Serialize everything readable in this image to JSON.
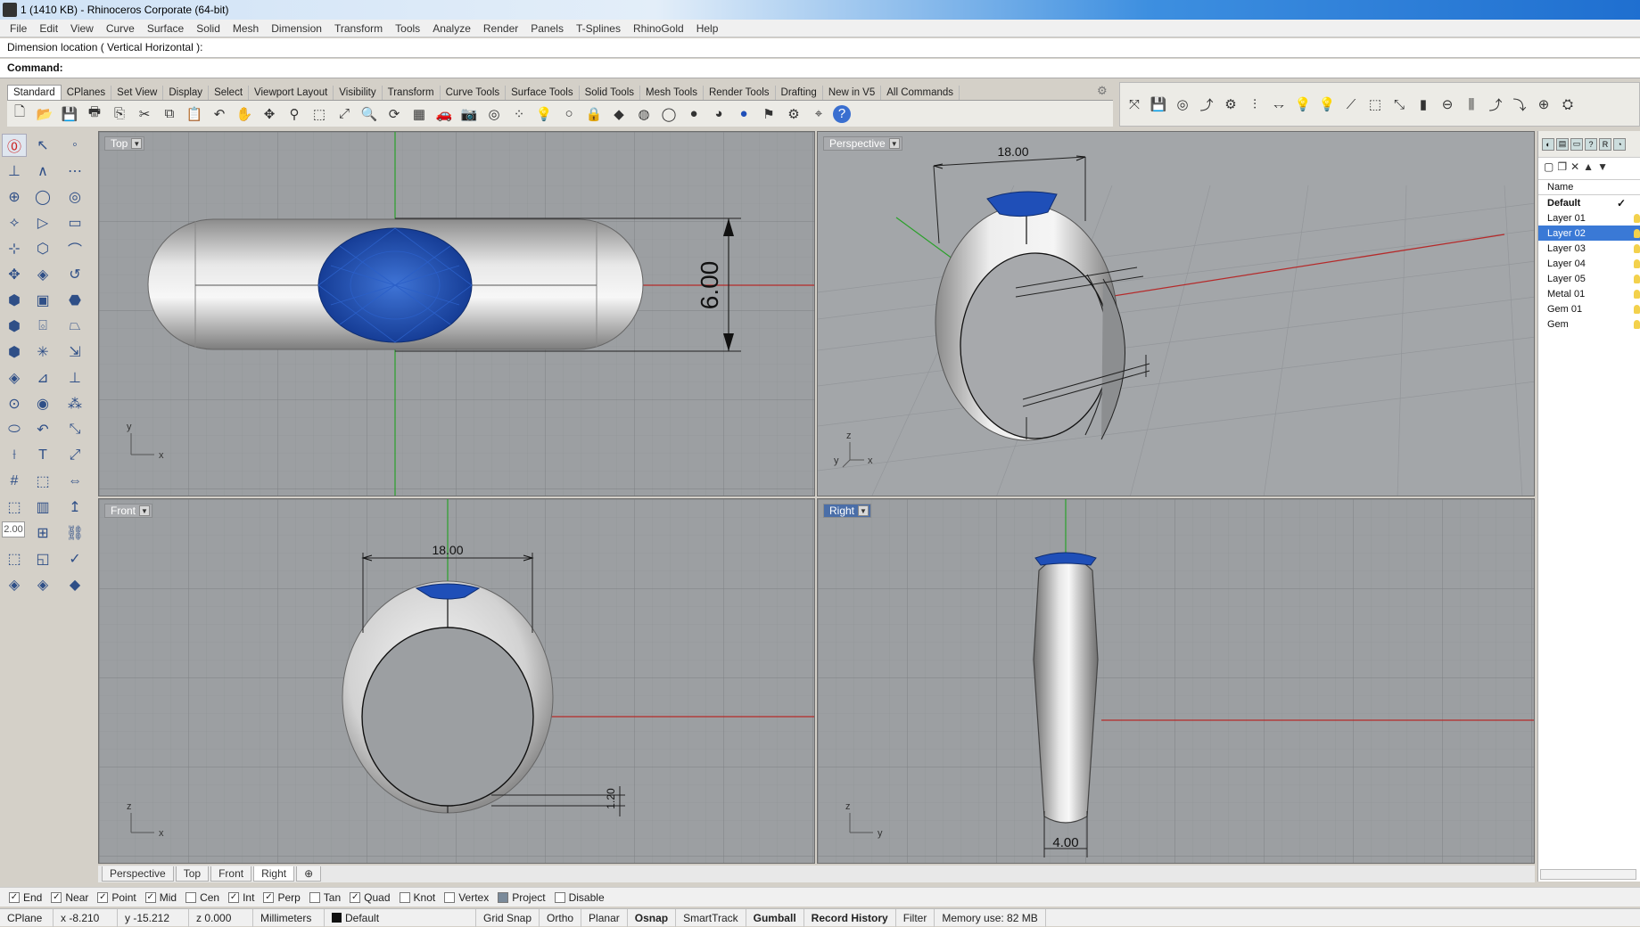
{
  "window": {
    "title": "1 (1410 KB) - Rhinoceros Corporate (64-bit)"
  },
  "menu": [
    "File",
    "Edit",
    "View",
    "Curve",
    "Surface",
    "Solid",
    "Mesh",
    "Dimension",
    "Transform",
    "Tools",
    "Analyze",
    "Render",
    "Panels",
    "T-Splines",
    "RhinoGold",
    "Help"
  ],
  "command": {
    "history": "Dimension location ( Vertical  Horizontal ):",
    "prompt": "Command:"
  },
  "toolbar_tabs": [
    "Standard",
    "CPlanes",
    "Set View",
    "Display",
    "Select",
    "Viewport Layout",
    "Visibility",
    "Transform",
    "Curve Tools",
    "Surface Tools",
    "Solid Tools",
    "Mesh Tools",
    "Render Tools",
    "Drafting",
    "New in V5",
    "All Commands"
  ],
  "toolbar_icons": [
    "new-icon",
    "open-icon",
    "save-icon",
    "print-icon",
    "import-icon",
    "cut-icon",
    "copy-icon",
    "paste-icon",
    "undo-icon",
    "pan-icon",
    "rotate-view-icon",
    "zoom-icon",
    "zoom-window-icon",
    "zoom-extents-icon",
    "zoom-selected-icon",
    "zoom-all-icon",
    "viewport-grid-icon",
    "car-icon",
    "camera-icon",
    "cplane-icon",
    "points-icon",
    "light-icon",
    "light-off-icon",
    "lock-icon",
    "material-icon",
    "color-wheel-icon",
    "wireframe-sphere-icon",
    "shaded-sphere-icon",
    "rendered-sphere-icon",
    "blue-sphere-icon",
    "flag-icon",
    "gears-icon",
    "snap-icon",
    "help-icon"
  ],
  "left_toolbar": {
    "number_field": "2.00"
  },
  "viewports": {
    "top": {
      "label": "Top",
      "dimension": "6.00",
      "axis_x": "x",
      "axis_y": "y"
    },
    "perspective": {
      "label": "Perspective",
      "dimension": "18.00",
      "axis_x": "x",
      "axis_y": "y",
      "axis_z": "z"
    },
    "front": {
      "label": "Front",
      "dimension": "18.00",
      "dimension2": "1.20",
      "axis_x": "x",
      "axis_z": "z"
    },
    "right": {
      "label": "Right",
      "dimension": "4.00",
      "axis_y": "y",
      "axis_z": "z"
    }
  },
  "viewport_tabs": [
    "Perspective",
    "Top",
    "Front",
    "Right"
  ],
  "layers": {
    "header": "Name",
    "items": [
      {
        "name": "Default",
        "current": true
      },
      {
        "name": "Layer 01"
      },
      {
        "name": "Layer 02",
        "selected": true
      },
      {
        "name": "Layer 03"
      },
      {
        "name": "Layer 04"
      },
      {
        "name": "Layer 05"
      },
      {
        "name": "Metal 01"
      },
      {
        "name": "Gem 01"
      },
      {
        "name": "Gem"
      }
    ],
    "current_mark": "✓"
  },
  "osnap": [
    {
      "label": "End",
      "checked": true
    },
    {
      "label": "Near",
      "checked": true
    },
    {
      "label": "Point",
      "checked": true
    },
    {
      "label": "Mid",
      "checked": true
    },
    {
      "label": "Cen",
      "checked": false
    },
    {
      "label": "Int",
      "checked": true
    },
    {
      "label": "Perp",
      "checked": true
    },
    {
      "label": "Tan",
      "checked": false
    },
    {
      "label": "Quad",
      "checked": true
    },
    {
      "label": "Knot",
      "checked": false
    },
    {
      "label": "Vertex",
      "checked": false
    },
    {
      "label": "Project",
      "checked": false
    },
    {
      "label": "Disable",
      "checked": false
    }
  ],
  "status": {
    "cplane": "CPlane",
    "x": "x -8.210",
    "y": "y -15.212",
    "z": "z 0.000",
    "units": "Millimeters",
    "layer": "Default",
    "grid_snap": "Grid Snap",
    "ortho": "Ortho",
    "planar": "Planar",
    "osnap": "Osnap",
    "smarttrack": "SmartTrack",
    "gumball": "Gumball",
    "record_history": "Record History",
    "filter": "Filter",
    "memory": "Memory use: 82 MB"
  },
  "colors": {
    "viewport_bg": "#9c9fa2",
    "gem": "#1f4fb8",
    "x_axis": "#b52a2a",
    "y_axis": "#2a9a2a",
    "selected_layer": "#3a79d6"
  }
}
